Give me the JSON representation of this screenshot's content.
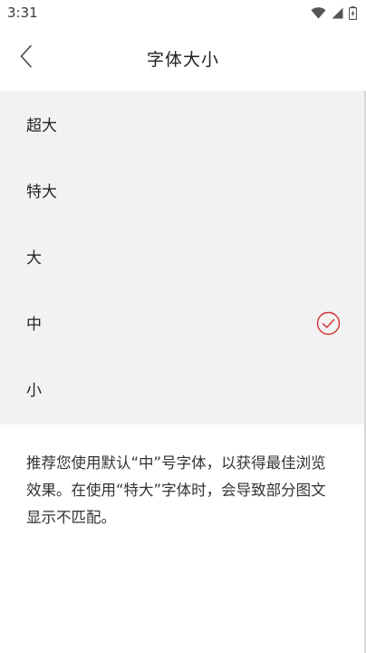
{
  "status_bar": {
    "time": "3:31",
    "icons": [
      "wifi-icon",
      "cell-signal-icon",
      "battery-icon"
    ]
  },
  "header": {
    "title": "字体大小",
    "back_icon": "chevron-left-icon"
  },
  "options": [
    {
      "label": "超大",
      "selected": false
    },
    {
      "label": "特大",
      "selected": false
    },
    {
      "label": "大",
      "selected": false
    },
    {
      "label": "中",
      "selected": true
    },
    {
      "label": "小",
      "selected": false
    }
  ],
  "note": {
    "text": "推荐您使用默认“中”号字体，以获得最佳浏览效果。在使用“特大”字体时，会导致部分图文显示不匹配。"
  },
  "colors": {
    "accent": "#d4323c",
    "options_bg": "#f2f2f2"
  }
}
